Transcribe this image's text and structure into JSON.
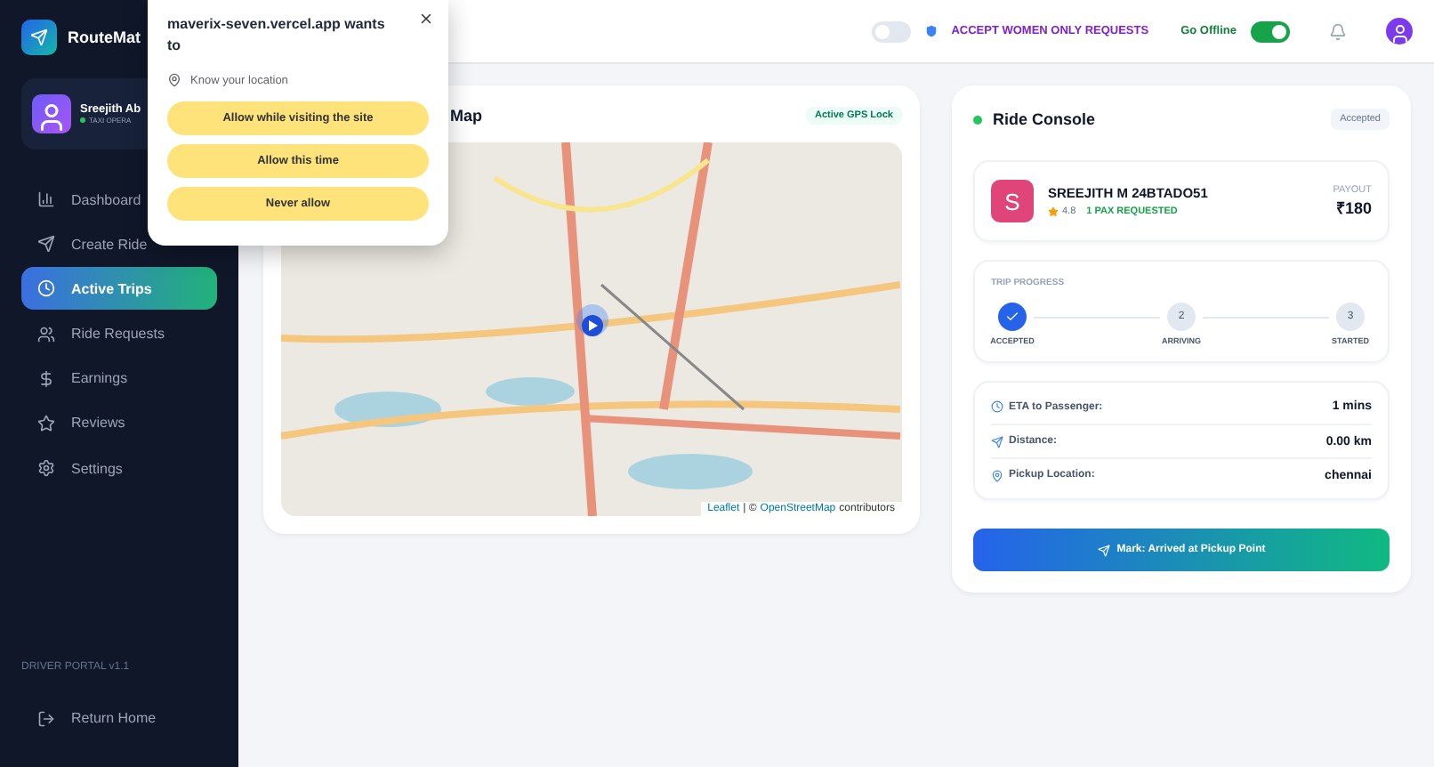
{
  "sidebar": {
    "brand": "RouteMat",
    "user": {
      "name": "Sreejith Ab",
      "role": "TAXI OPERA",
      "online": true
    },
    "nav": [
      {
        "label": "Dashboard",
        "selected": false
      },
      {
        "label": "Create Ride",
        "selected": false
      },
      {
        "label": "Active Trips",
        "selected": true
      },
      {
        "label": "Ride Requests",
        "selected": false
      },
      {
        "label": "Earnings",
        "selected": false
      },
      {
        "label": "Reviews",
        "selected": false
      },
      {
        "label": "Settings",
        "selected": false
      }
    ],
    "footer_label": "DRIVER PORTAL v1.1",
    "return_home": "Return Home"
  },
  "topbar": {
    "women_only": {
      "label": "ACCEPT WOMEN ONLY REQUESTS",
      "on": false
    },
    "go_offline": {
      "label": "Go Offline",
      "on": true
    }
  },
  "permission_popup": {
    "title": "maverix-seven.vercel.app wants to",
    "request": "Know your location",
    "buttons": [
      "Allow while visiting the site",
      "Allow this time",
      "Never allow"
    ]
  },
  "map_card": {
    "title": "Map",
    "badge": "Active GPS Lock",
    "attribution": {
      "leaflet": "Leaflet",
      "separator": "| ©",
      "osm": "OpenStreetMap",
      "suffix": "contributors"
    }
  },
  "ride_console": {
    "title": "Ride Console",
    "live": true,
    "status": "Accepted",
    "passenger": {
      "initial": "S",
      "name": "SREEJITH M 24BTADO51",
      "rating": "4.8",
      "pax": "1 PAX REQUESTED",
      "payout_label": "PAYOUT",
      "payout": "₹180"
    },
    "progress": {
      "label": "TRIP PROGRESS",
      "steps": [
        {
          "label": "ACCEPTED",
          "done": true
        },
        {
          "number": "2",
          "label": "ARRIVING",
          "done": false
        },
        {
          "number": "3",
          "label": "STARTED",
          "done": false
        }
      ]
    },
    "details": [
      {
        "label": "ETA to Passenger:",
        "value": "1 mins"
      },
      {
        "label": "Distance:",
        "value": "0.00 km"
      },
      {
        "label": "Pickup Location:",
        "value": "chennai"
      }
    ],
    "action": "Mark: Arrived at Pickup Point"
  }
}
